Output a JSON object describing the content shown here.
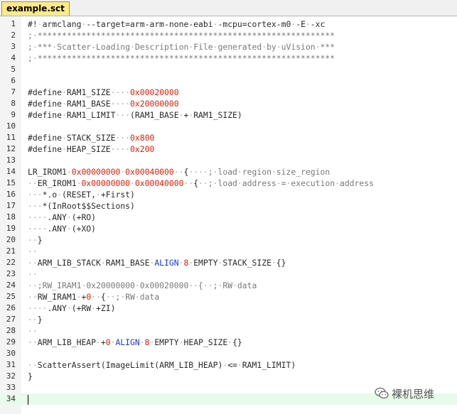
{
  "tab": {
    "title": "example.sct"
  },
  "lines": [
    [
      {
        "t": "#!·armclang·--target=arm-arm-none-eabi·-mcpu=cortex-m0·-E·-xc",
        "c": ""
      }
    ],
    [
      {
        "t": ";·*************************************************************",
        "c": "cmt"
      }
    ],
    [
      {
        "t": ";·***·Scatter-Loading·Description·File·generated·by·uVision·***",
        "c": "cmt"
      }
    ],
    [
      {
        "t": ";·*************************************************************",
        "c": "cmt"
      }
    ],
    [],
    [],
    [
      {
        "t": "#define·RAM1_SIZE····",
        "c": ""
      },
      {
        "t": "0x00020000",
        "c": "num"
      }
    ],
    [
      {
        "t": "#define·RAM1_BASE····",
        "c": ""
      },
      {
        "t": "0x20000000",
        "c": "num"
      }
    ],
    [
      {
        "t": "#define·RAM1_LIMIT···(RAM1_BASE·+·RAM1_SIZE)",
        "c": ""
      }
    ],
    [],
    [
      {
        "t": "#define·STACK_SIZE···",
        "c": ""
      },
      {
        "t": "0x800",
        "c": "num"
      }
    ],
    [
      {
        "t": "#define·HEAP_SIZE····",
        "c": ""
      },
      {
        "t": "0x200",
        "c": "num"
      }
    ],
    [],
    [
      {
        "t": "LR_IROM1·",
        "c": ""
      },
      {
        "t": "0x00000000",
        "c": "num"
      },
      {
        "t": "·",
        "c": ""
      },
      {
        "t": "0x00040000",
        "c": "num"
      },
      {
        "t": "··{····",
        "c": ""
      },
      {
        "t": ";·load·region·size_region",
        "c": "cmt"
      }
    ],
    [
      {
        "t": "··ER_IROM1·",
        "c": ""
      },
      {
        "t": "0x00000000",
        "c": "num"
      },
      {
        "t": "·",
        "c": ""
      },
      {
        "t": "0x00040000",
        "c": "num"
      },
      {
        "t": "··{··",
        "c": ""
      },
      {
        "t": ";·load·address·=·execution·address",
        "c": "cmt"
      }
    ],
    [
      {
        "t": "···*.o·(RESET,·+First)",
        "c": ""
      }
    ],
    [
      {
        "t": "···*(InRoot$$Sections)",
        "c": ""
      }
    ],
    [
      {
        "t": "····.ANY·(+RO)",
        "c": ""
      }
    ],
    [
      {
        "t": "····.ANY·(+XO)",
        "c": ""
      }
    ],
    [
      {
        "t": "··}",
        "c": ""
      }
    ],
    [
      {
        "t": "··",
        "c": ""
      }
    ],
    [
      {
        "t": "··ARM_LIB_STACK·RAM1_BASE·",
        "c": ""
      },
      {
        "t": "ALIGN",
        "c": "kw"
      },
      {
        "t": "·",
        "c": ""
      },
      {
        "t": "8",
        "c": "num"
      },
      {
        "t": "·EMPTY·STACK_SIZE·{}",
        "c": ""
      }
    ],
    [
      {
        "t": "··",
        "c": ""
      }
    ],
    [
      {
        "t": "··;RW_IRAM1·0x20000000·0x00020000··{··;·RW·data",
        "c": "cmt"
      }
    ],
    [
      {
        "t": "··RW_IRAM1·+",
        "c": ""
      },
      {
        "t": "0",
        "c": "num"
      },
      {
        "t": "··{··",
        "c": ""
      },
      {
        "t": ";·RW·data",
        "c": "cmt"
      }
    ],
    [
      {
        "t": "····.ANY·(+RW·+ZI)",
        "c": ""
      }
    ],
    [
      {
        "t": "··}",
        "c": ""
      }
    ],
    [
      {
        "t": "··",
        "c": ""
      }
    ],
    [
      {
        "t": "··ARM_LIB_HEAP·+",
        "c": ""
      },
      {
        "t": "0",
        "c": "num"
      },
      {
        "t": "·",
        "c": ""
      },
      {
        "t": "ALIGN",
        "c": "kw"
      },
      {
        "t": "·",
        "c": ""
      },
      {
        "t": "8",
        "c": "num"
      },
      {
        "t": "·EMPTY·HEAP_SIZE·{}",
        "c": ""
      }
    ],
    [],
    [
      {
        "t": "··ScatterAssert(ImageLimit(ARM_LIB_HEAP)·<=·RAM1_LIMIT)",
        "c": ""
      }
    ],
    [
      {
        "t": "}",
        "c": ""
      }
    ],
    [],
    []
  ],
  "current_line": 34,
  "watermark": {
    "text": "裸机思维",
    "icon": "wechat-icon"
  },
  "colors": {
    "number": "#d81e06",
    "keyword": "#1a3ad8",
    "whitespace": "#a8a8a8",
    "current_line": "#e6fbe8",
    "tab": "#ffe98a"
  }
}
